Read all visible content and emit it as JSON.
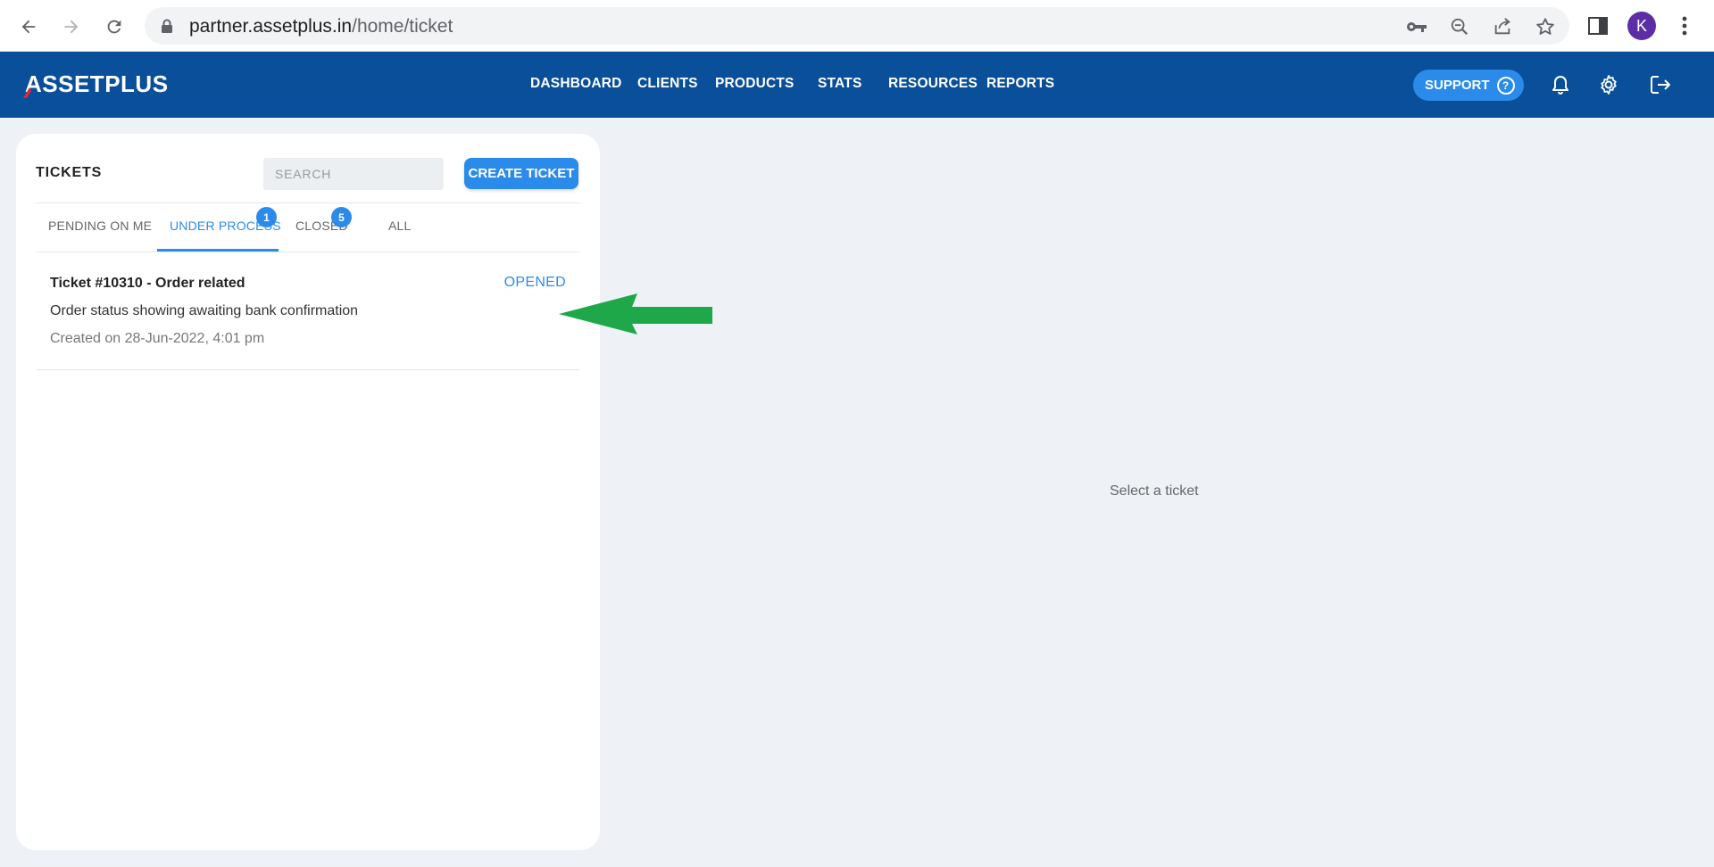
{
  "browser": {
    "url_host": "partner.assetplus.in",
    "url_path": "/home/ticket",
    "profile_initial": "K",
    "icons": [
      "back-arrow-icon",
      "forward-arrow-icon",
      "reload-icon",
      "lock-icon",
      "key-icon",
      "zoom-out-icon",
      "share-icon",
      "star-icon",
      "side-panel-icon",
      "more-vert-icon"
    ]
  },
  "header": {
    "logo": "SSETPLUS",
    "logo_initial": "A",
    "nav": [
      "DASHBOARD",
      "CLIENTS",
      "PRODUCTS",
      "STATS",
      "RESOURCES",
      "REPORTS"
    ],
    "support_label": "SUPPORT",
    "brand_color": "#0a4f9a",
    "accent_color": "#2a8bea",
    "icons": [
      "help-circle-icon",
      "bell-icon",
      "gear-icon",
      "logout-icon"
    ]
  },
  "tickets_panel": {
    "title": "TICKETS",
    "search_placeholder": "SEARCH",
    "create_label": "CREATE TICKET",
    "tabs": [
      {
        "label": "PENDING ON ME",
        "badge": null
      },
      {
        "label": "UNDER PROCESS",
        "badge": "1",
        "active": true
      },
      {
        "label": "CLOSED",
        "badge": "5"
      },
      {
        "label": "ALL",
        "badge": null
      }
    ],
    "tickets": [
      {
        "title": "Ticket #10310 - Order related",
        "description": "Order status showing awaiting bank confirmation",
        "created": "Created on 28-Jun-2022, 4:01 pm",
        "status": "OPENED"
      }
    ]
  },
  "detail": {
    "empty_message": "Select a ticket"
  },
  "annotation": {
    "arrow_color": "#1ea84a"
  }
}
